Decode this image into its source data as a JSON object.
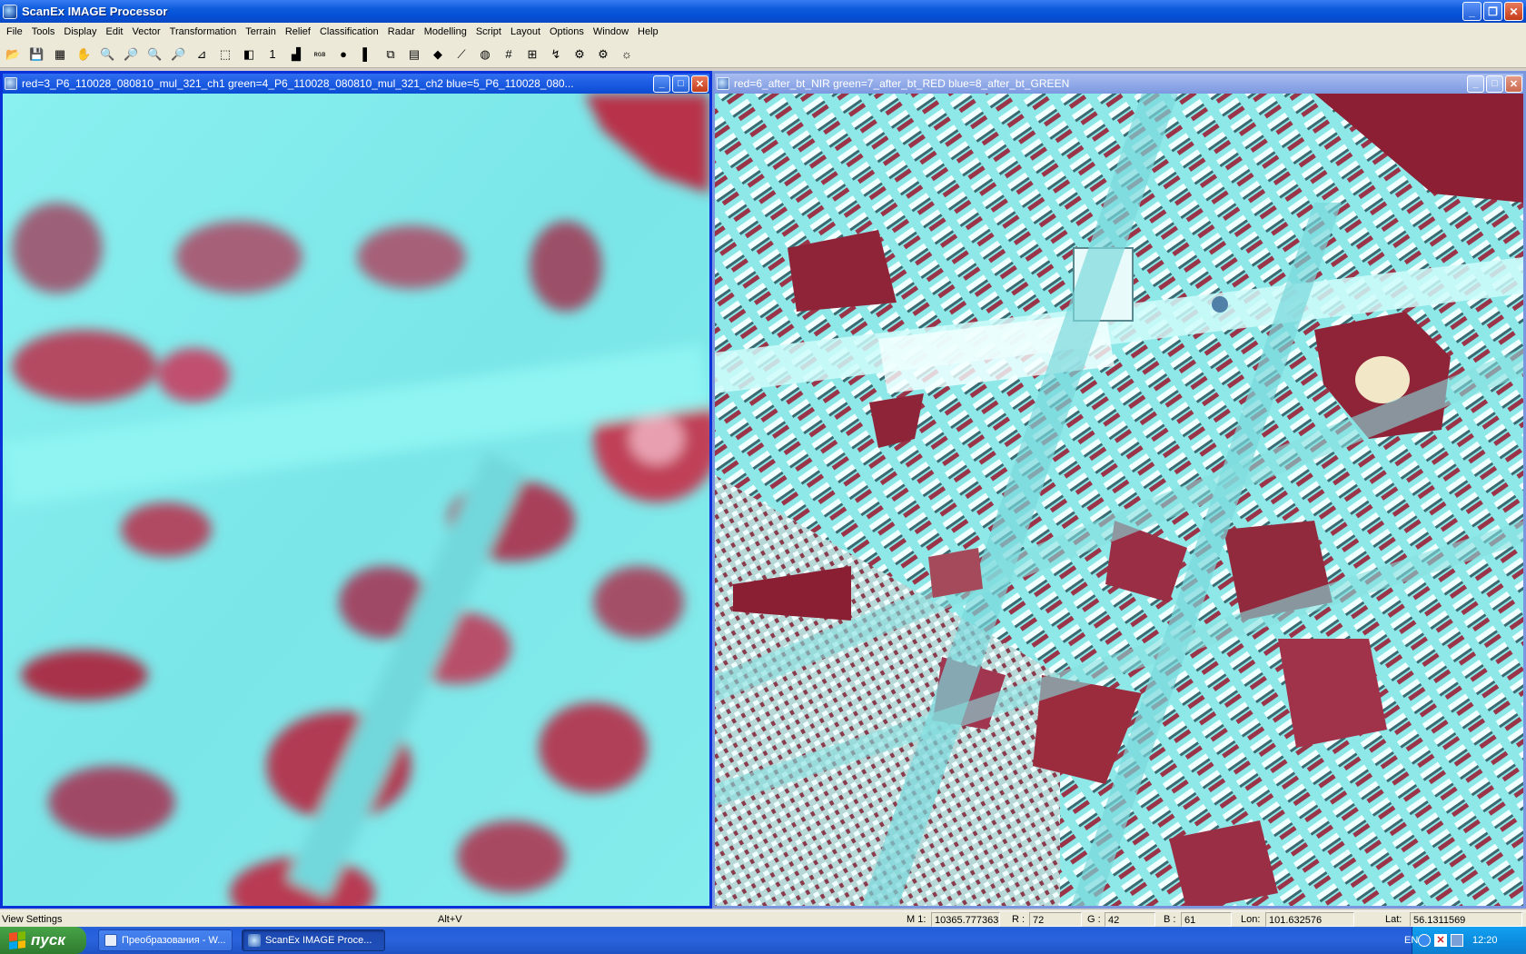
{
  "app": {
    "title": "ScanEx IMAGE Processor"
  },
  "menu": [
    "File",
    "Tools",
    "Display",
    "Edit",
    "Vector",
    "Transformation",
    "Terrain",
    "Relief",
    "Classification",
    "Radar",
    "Modelling",
    "Script",
    "Layout",
    "Options",
    "Window",
    "Help"
  ],
  "toolbar": [
    {
      "name": "open-icon",
      "glyph": "📂"
    },
    {
      "name": "save-icon",
      "glyph": "💾"
    },
    {
      "name": "view-settings-icon",
      "glyph": "▦"
    },
    {
      "name": "pan-hand-icon",
      "glyph": "✋"
    },
    {
      "name": "zoom-window-icon",
      "glyph": "🔍"
    },
    {
      "name": "zoom-in-icon",
      "glyph": "🔎"
    },
    {
      "name": "zoom-out-icon",
      "glyph": "🔍"
    },
    {
      "name": "zoom-fit-icon",
      "glyph": "🔎"
    },
    {
      "name": "measure-icon",
      "glyph": "⊿"
    },
    {
      "name": "select-rectangle-icon",
      "glyph": "⬚"
    },
    {
      "name": "overview-icon",
      "glyph": "◧"
    },
    {
      "name": "one-to-one-icon",
      "glyph": "1"
    },
    {
      "name": "histogram-icon",
      "glyph": "▟"
    },
    {
      "name": "rgb-bands-icon",
      "glyph": "ʀɢʙ"
    },
    {
      "name": "color-composite-icon",
      "glyph": "●"
    },
    {
      "name": "grayscale-icon",
      "glyph": "▌"
    },
    {
      "name": "layers-icon",
      "glyph": "⧉"
    },
    {
      "name": "properties-icon",
      "glyph": "▤"
    },
    {
      "name": "vector-layer-icon",
      "glyph": "◆"
    },
    {
      "name": "profile-icon",
      "glyph": "⟋"
    },
    {
      "name": "globe-icon",
      "glyph": "◍"
    },
    {
      "name": "grid-icon",
      "glyph": "#"
    },
    {
      "name": "georeference-icon",
      "glyph": "⊞"
    },
    {
      "name": "transform-icon",
      "glyph": "↯"
    },
    {
      "name": "gear-icon",
      "glyph": "⚙"
    },
    {
      "name": "close-settings-icon",
      "glyph": "⚙"
    },
    {
      "name": "sun-icon",
      "glyph": "☼"
    }
  ],
  "windows": {
    "left": {
      "title": "red=3_P6_110028_080810_mul_321_ch1  green=4_P6_110028_080810_mul_321_ch2  blue=5_P6_110028_080..."
    },
    "right": {
      "title": "red=6_after_bt_NIR  green=7_after_bt_RED  blue=8_after_bt_GREEN"
    }
  },
  "colors": {
    "vegetation": "#9b2c3e",
    "urban": "#7fe9e9",
    "active_title": "#0a4bd4",
    "inactive_title": "#7c98e0"
  },
  "status": {
    "message": "View Settings",
    "shortcut": "Alt+V",
    "m_label": "M 1:",
    "m_value": "10365.777363",
    "r_label": "R :",
    "r_value": "72",
    "g_label": "G :",
    "g_value": "42",
    "b_label": "B :",
    "b_value": "61",
    "lon_label": "Lon:",
    "lon_value": "101.632576",
    "lat_label": "Lat:",
    "lat_value": "56.1311569"
  },
  "taskbar": {
    "start": "пуск",
    "tasks": [
      "Преобразования - W...",
      "ScanEx IMAGE Proce..."
    ],
    "lang": "EN",
    "clock": "12:20"
  }
}
